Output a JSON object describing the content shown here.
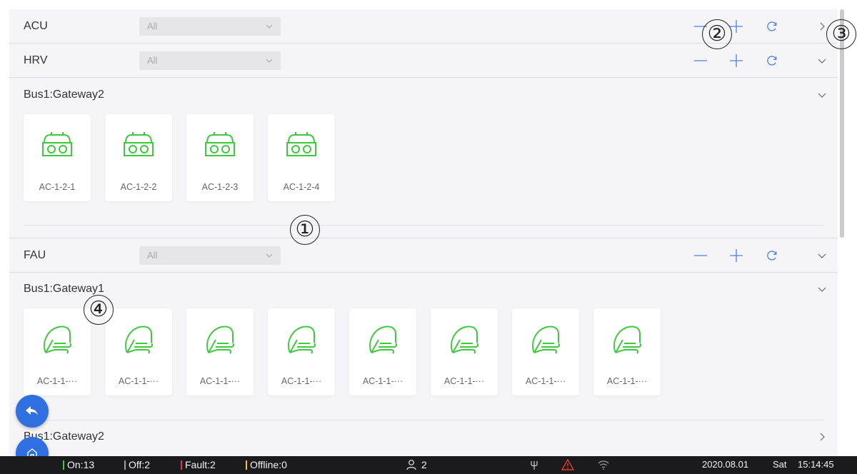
{
  "groups": {
    "acu": {
      "title": "ACU",
      "filter_value": "All"
    },
    "hrv": {
      "title": "HRV",
      "filter_value": "All"
    },
    "fau": {
      "title": "FAU",
      "filter_value": "All"
    }
  },
  "hrv_gateway": {
    "title": "Bus1:Gateway2",
    "devices": [
      "AC-1-2-1",
      "AC-1-2-2",
      "AC-1-2-3",
      "AC-1-2-4"
    ]
  },
  "fau_gateway1": {
    "title": "Bus1:Gateway1",
    "devices": [
      "AC-1-1-···",
      "AC-1-1-···",
      "AC-1-1-···",
      "AC-1-1-···",
      "AC-1-1-···",
      "AC-1-1-···",
      "AC-1-1-···",
      "AC-1-1-···"
    ]
  },
  "fau_gateway2": {
    "title": "Bus1:Gateway2"
  },
  "markers": [
    "①",
    "②",
    "③",
    "④"
  ],
  "status": {
    "on": "On:13",
    "off": "Off:2",
    "fault": "Fault:2",
    "offline": "Offline:0",
    "users": "2",
    "date": "2020.08.01",
    "weekday": "Sat",
    "time": "15:14:45"
  },
  "colors": {
    "accent": "#2f6fe0",
    "device_green": "#3ec93e",
    "on": "#3ec93e",
    "off": "#9e9e9e",
    "fault": "#e53935",
    "offline": "#f4c430",
    "warning": "#e53935"
  },
  "icons": {
    "minus": "minus-icon",
    "plus": "plus-icon",
    "refresh": "refresh-icon",
    "expand": "chevron-down-icon",
    "collapse": "chevron-right-icon",
    "hrv_device": "hrv-unit-icon",
    "fau_device": "leaf-fan-icon",
    "back": "back-arrow-icon",
    "home": "home-icon",
    "user": "user-icon",
    "plug": "plug-icon",
    "warning": "warning-icon",
    "wifi": "wifi-icon"
  }
}
